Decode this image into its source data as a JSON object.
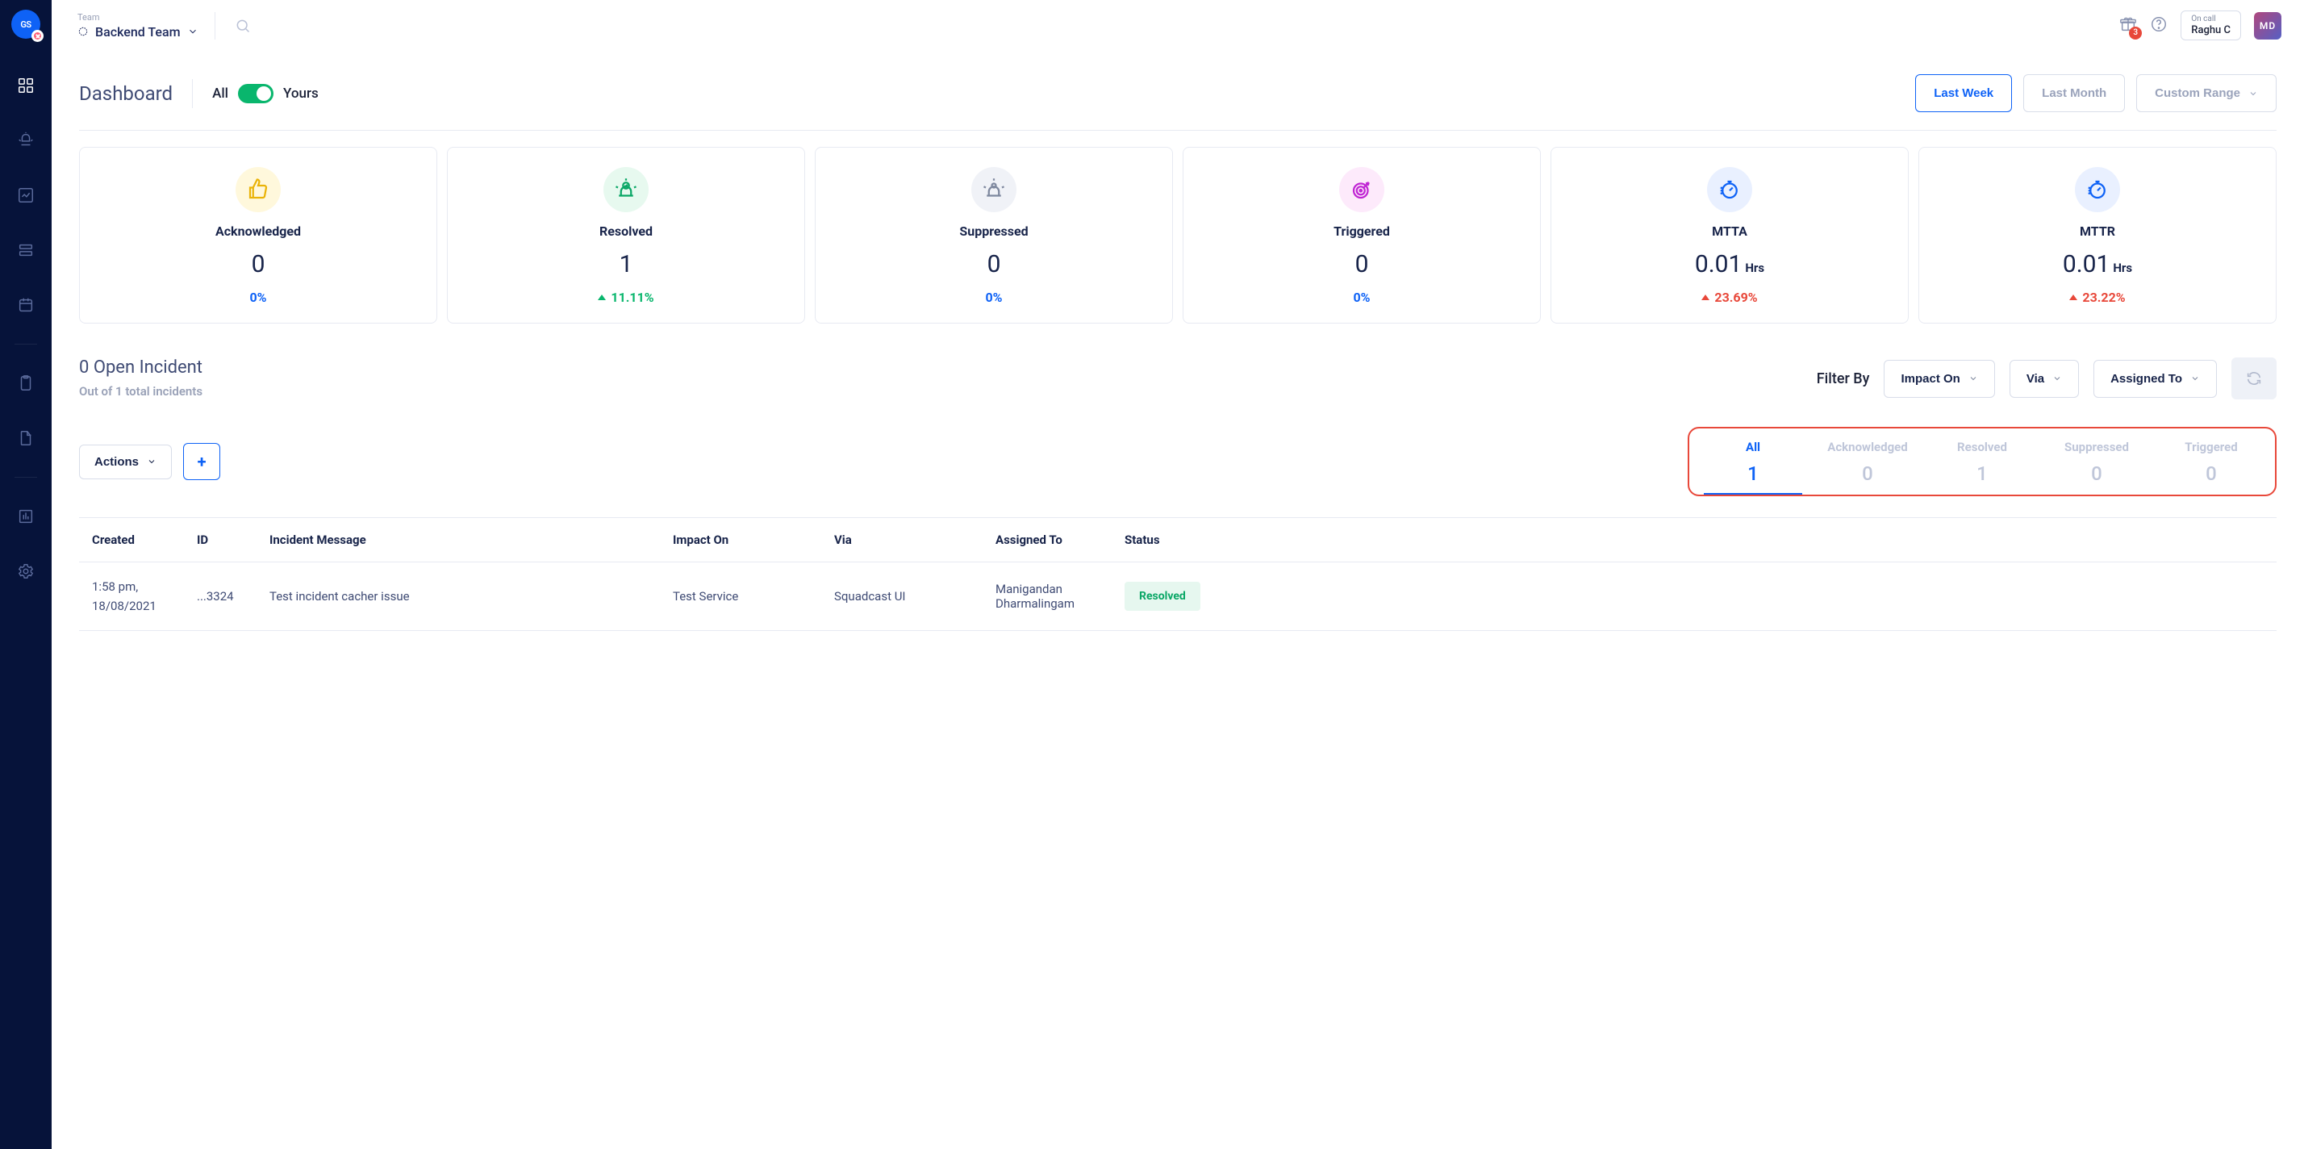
{
  "topbar": {
    "team_label": "Team",
    "team_name": "Backend Team",
    "gift_badge": "3",
    "oncall_label": "On call",
    "oncall_name": "Raghu C",
    "avatar_initials": "MD",
    "logo_initials": "GS"
  },
  "header": {
    "title": "Dashboard",
    "toggle_all": "All",
    "toggle_yours": "Yours",
    "range": {
      "last_week": "Last Week",
      "last_month": "Last Month",
      "custom": "Custom Range"
    }
  },
  "cards": {
    "acknowledged": {
      "label": "Acknowledged",
      "value": "0",
      "delta": "0%"
    },
    "resolved": {
      "label": "Resolved",
      "value": "1",
      "delta": "11.11%"
    },
    "suppressed": {
      "label": "Suppressed",
      "value": "0",
      "delta": "0%"
    },
    "triggered": {
      "label": "Triggered",
      "value": "0",
      "delta": "0%"
    },
    "mtta": {
      "label": "MTTA",
      "value": "0.01",
      "unit": "Hrs",
      "delta": "23.69%"
    },
    "mttr": {
      "label": "MTTR",
      "value": "0.01",
      "unit": "Hrs",
      "delta": "23.22%"
    }
  },
  "open": {
    "title": "0 Open Incident",
    "subtitle": "Out of 1 total incidents"
  },
  "filters": {
    "label": "Filter By",
    "impact_on": "Impact On",
    "via": "Via",
    "assigned_to": "Assigned To"
  },
  "actions": {
    "actions_label": "Actions"
  },
  "tabs": {
    "all": {
      "label": "All",
      "value": "1"
    },
    "acknowledged": {
      "label": "Acknowledged",
      "value": "0"
    },
    "resolved": {
      "label": "Resolved",
      "value": "1"
    },
    "suppressed": {
      "label": "Suppressed",
      "value": "0"
    },
    "triggered": {
      "label": "Triggered",
      "value": "0"
    }
  },
  "table": {
    "headers": {
      "created": "Created",
      "id": "ID",
      "message": "Incident Message",
      "impact_on": "Impact On",
      "via": "Via",
      "assigned_to": "Assigned To",
      "status": "Status"
    },
    "rows": [
      {
        "created_time": "1:58 pm,",
        "created_date": "18/08/2021",
        "id": "...3324",
        "message": "Test incident cacher issue",
        "impact_on": "Test Service",
        "via": "Squadcast UI",
        "assigned_to": "Manigandan Dharmalingam",
        "status": "Resolved"
      }
    ]
  }
}
